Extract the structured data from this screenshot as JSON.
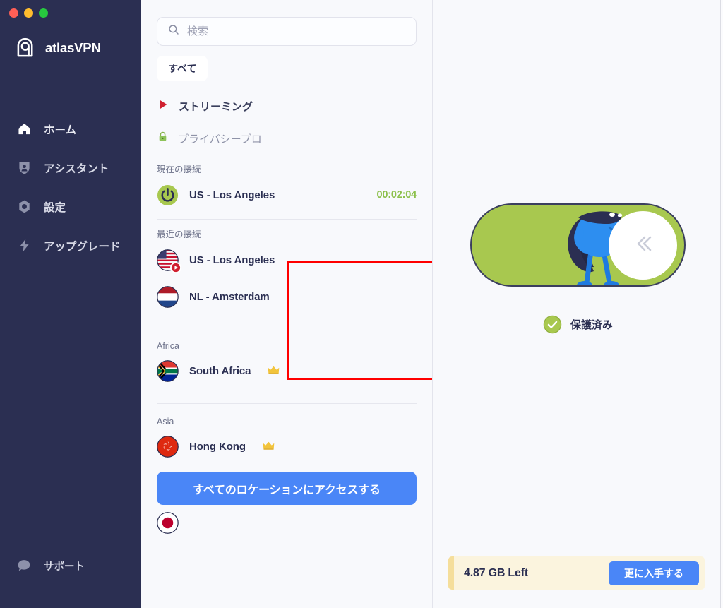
{
  "window": {
    "traffic_lights": [
      "close",
      "minimize",
      "maximize"
    ],
    "colors": {
      "sidebar_bg": "#2b2f52",
      "accent_blue": "#4a86f7",
      "accent_green": "#a8c84f",
      "timer_green": "#8cc04b",
      "annotation_red": "#ff0000",
      "quota_bg": "#fbf4de"
    }
  },
  "sidebar": {
    "brand": "atlasVPN",
    "brand_icon": "atlasvpn-logo-icon",
    "items": [
      {
        "label": "ホーム",
        "icon": "home-icon",
        "active": true
      },
      {
        "label": "アシスタント",
        "icon": "shield-person-icon",
        "active": false
      },
      {
        "label": "設定",
        "icon": "gear-icon",
        "active": false
      },
      {
        "label": "アップグレード",
        "icon": "lightning-bolt-icon",
        "active": false
      }
    ],
    "support": {
      "label": "サポート",
      "icon": "chat-bubble-icon"
    }
  },
  "list_panel": {
    "search": {
      "placeholder": "検索",
      "value": "",
      "icon": "search-icon"
    },
    "filter_chips": [
      {
        "label": "すべて",
        "selected": true
      }
    ],
    "quick_links": [
      {
        "label": "ストリーミング",
        "icon": "play-triangle-icon"
      },
      {
        "label": "プライバシープロ",
        "icon": "green-lock-icon"
      }
    ],
    "current_connection": {
      "heading": "現在の接続",
      "location": "US - Los Angeles",
      "timer": "00:02:04",
      "icon": "power-button-icon"
    },
    "recent_connections": {
      "heading": "最近の接続",
      "items": [
        {
          "label": "US - Los Angeles",
          "flag": "us-flag-icon",
          "badge": "streaming-play-badge"
        },
        {
          "label": "NL - Amsterdam",
          "flag": "nl-flag-icon",
          "badge": ""
        }
      ]
    },
    "regions": [
      {
        "heading": "Africa",
        "items": [
          {
            "label": "South Africa",
            "flag": "za-flag-icon",
            "premium": true,
            "premium_icon": "crown-icon"
          }
        ]
      },
      {
        "heading": "Asia",
        "items": [
          {
            "label": "Hong Kong",
            "flag": "hk-flag-icon",
            "premium": true,
            "premium_icon": "crown-icon"
          }
        ]
      }
    ],
    "cta_button": {
      "label": "すべてのロケーションにアクセスする"
    },
    "partial_item": {
      "flag": "jp-flag-icon"
    }
  },
  "right_panel": {
    "toggle": {
      "state": "on",
      "knob_icon": "double-chevron-left-icon",
      "mascot": "vpn-superhero-mascot"
    },
    "status": {
      "label": "保護済み",
      "icon": "green-check-circle-icon"
    },
    "quota": {
      "text": "4.87 GB Left",
      "button_label": "更に入手する"
    }
  }
}
